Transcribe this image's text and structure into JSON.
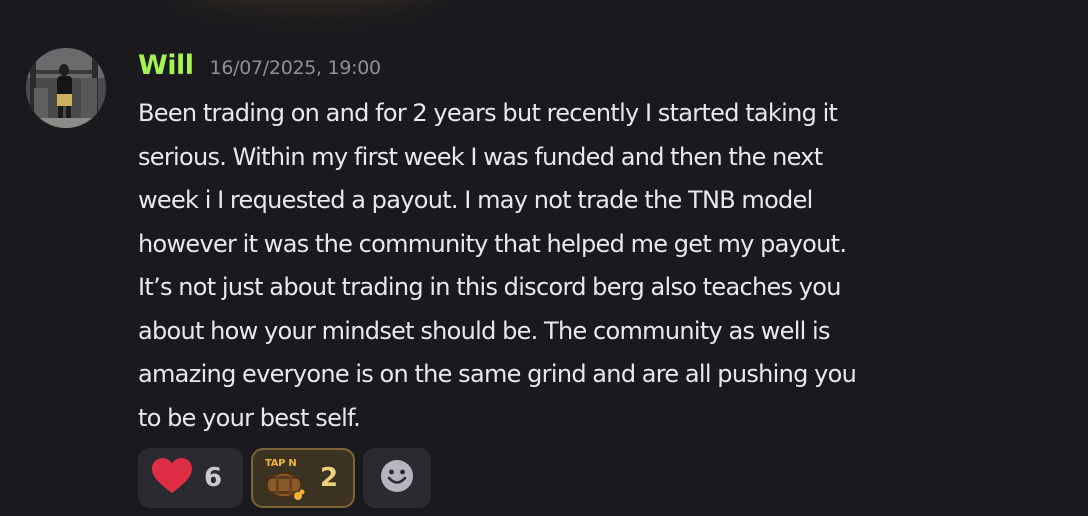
{
  "message": {
    "author": "Will",
    "timestamp": "16/07/2025, 19:00",
    "lines": [
      "Been trading on and for 2 years but recently I started taking it",
      "serious. Within my first week I was funded and then the next",
      "week i I requested a payout. I may not trade the TNB model",
      "however it was the community that helped me get my payout.",
      "It’s not just about trading in this discord berg also teaches you",
      "about how your mindset should be. The community as well is",
      "amazing everyone is on the same grind and are all pushing you",
      "to be your best self."
    ]
  },
  "reactions": [
    {
      "emoji": "heart-icon",
      "count": "6"
    },
    {
      "emoji": "tap-n-icon",
      "label": "TAP N",
      "count": "2"
    },
    {
      "emoji": "add-reaction-icon"
    }
  ],
  "colors": {
    "background": "#1a1a1e",
    "username": "#a5f352",
    "timestamp": "#8e9099",
    "text": "#e9e9ec",
    "reaction_bg": "#2a2a30",
    "reaction_active_bg": "#3b3222",
    "reaction_active_border": "#7e6535"
  }
}
